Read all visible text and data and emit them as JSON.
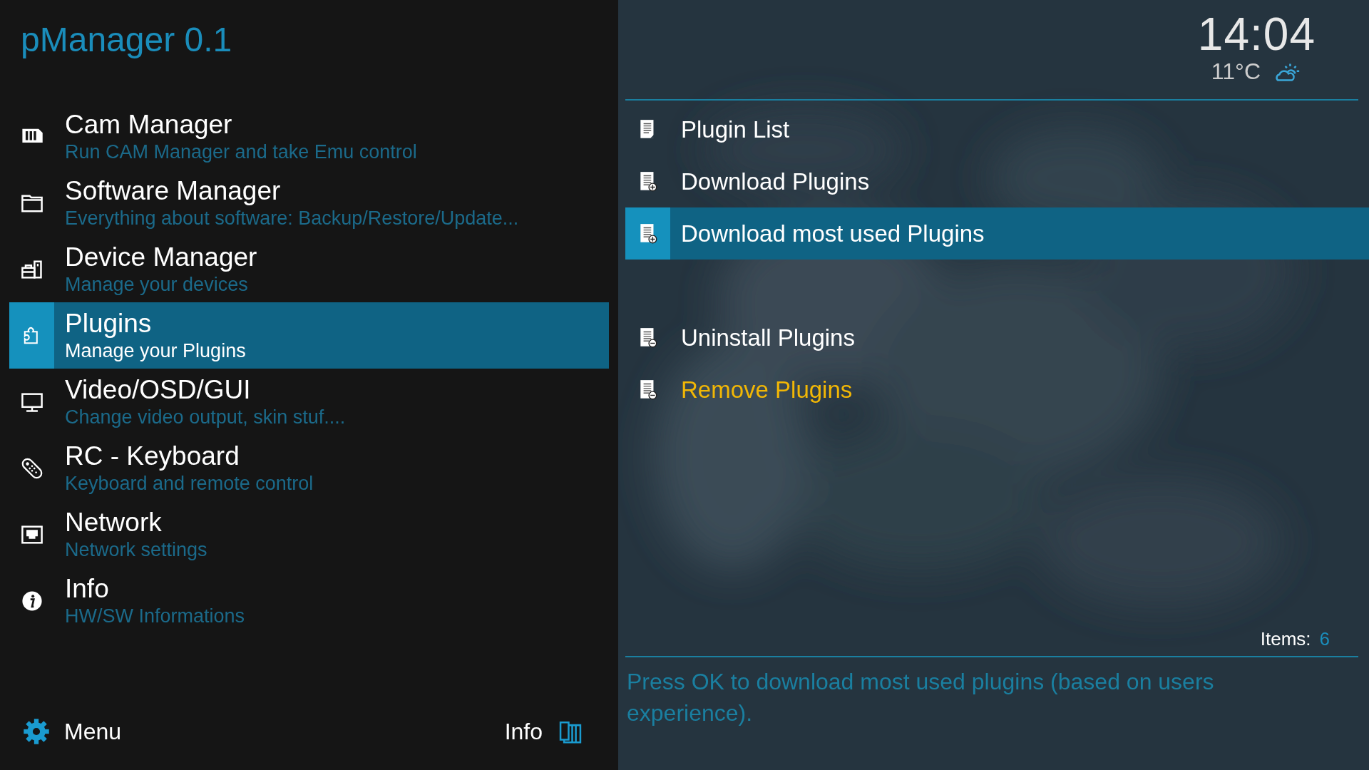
{
  "app": {
    "title": "pManager 0.1"
  },
  "menu": [
    {
      "title": "Cam Manager",
      "subtitle": "Run CAM Manager and take Emu control",
      "selected": false
    },
    {
      "title": "Software Manager",
      "subtitle": "Everything about software: Backup/Restore/Update...",
      "selected": false
    },
    {
      "title": "Device Manager",
      "subtitle": "Manage your devices",
      "selected": false
    },
    {
      "title": "Plugins",
      "subtitle": "Manage your Plugins",
      "selected": true
    },
    {
      "title": "Video/OSD/GUI",
      "subtitle": "Change video output, skin stuf....",
      "selected": false
    },
    {
      "title": "RC - Keyboard",
      "subtitle": "Keyboard and remote control",
      "selected": false
    },
    {
      "title": "Network",
      "subtitle": "Network settings",
      "selected": false
    },
    {
      "title": "Info",
      "subtitle": "HW/SW Informations",
      "selected": false
    }
  ],
  "footer": {
    "menu_label": "Menu",
    "info_label": "Info"
  },
  "clock": {
    "time": "14:04",
    "temperature": "11°C"
  },
  "submenu": [
    {
      "label": "Plugin List",
      "kind": "list",
      "selected": false,
      "color": "#ffffff",
      "gap_before": false
    },
    {
      "label": "Download Plugins",
      "kind": "add",
      "selected": false,
      "color": "#ffffff",
      "gap_before": false
    },
    {
      "label": "Download most used Plugins",
      "kind": "add",
      "selected": true,
      "color": "#ffffff",
      "gap_before": false
    },
    {
      "label": "Uninstall Plugins",
      "kind": "remove",
      "selected": false,
      "color": "#ffffff",
      "gap_before": true
    },
    {
      "label": "Remove Plugins",
      "kind": "remove",
      "selected": false,
      "color": "#f2b705",
      "gap_before": false
    }
  ],
  "items_count": {
    "label": "Items:",
    "value": "6"
  },
  "description": "Press OK to download most used plugins (based on users experience)."
}
